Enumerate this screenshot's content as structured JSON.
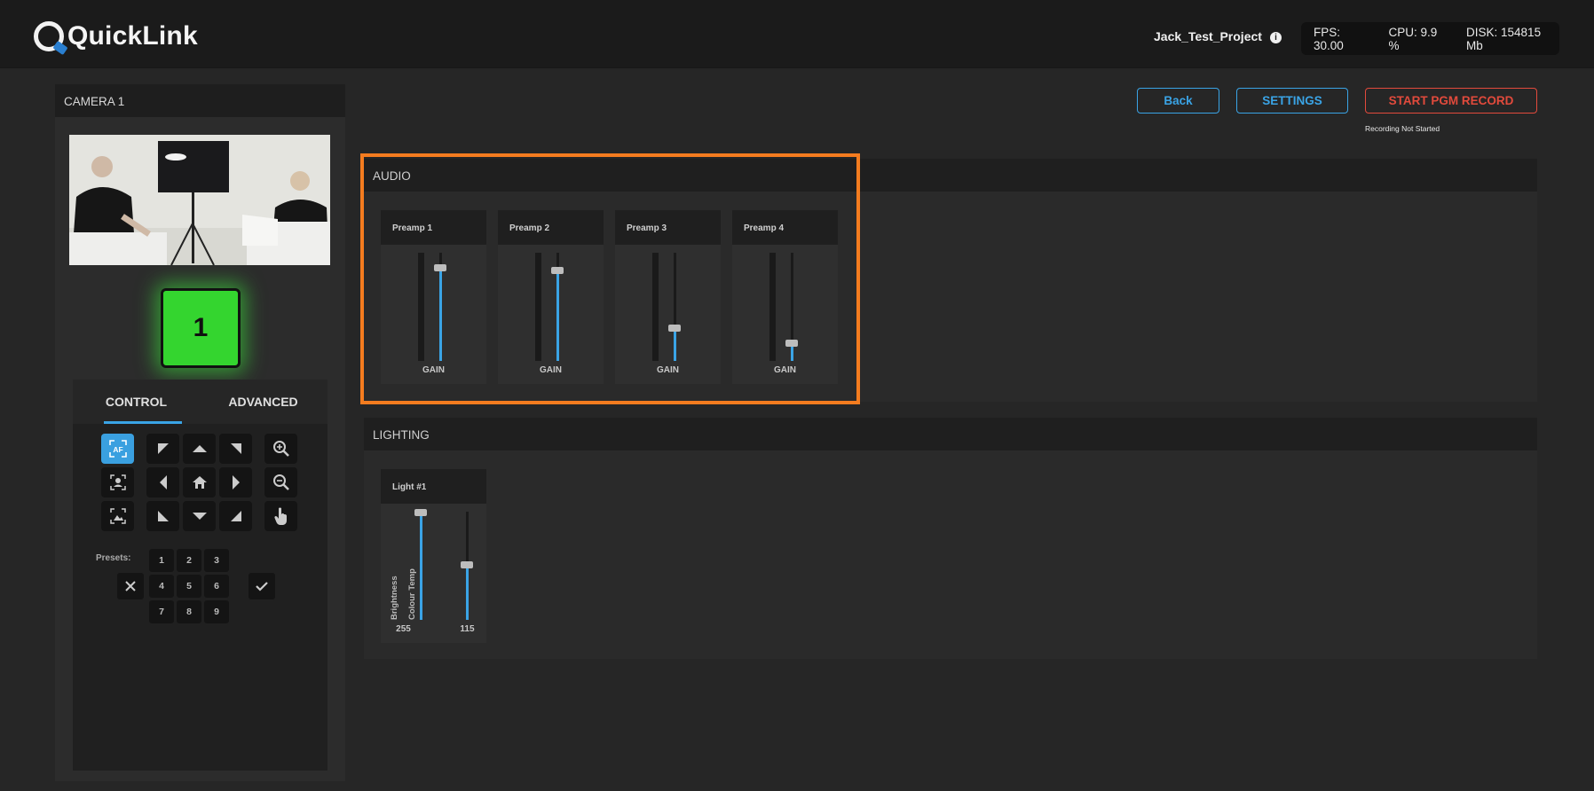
{
  "app": {
    "logo_text": "QuickLink",
    "project": "Jack_Test_Project"
  },
  "stats": {
    "fps": "FPS: 30.00",
    "cpu": "CPU: 9.9 %",
    "disk": "DISK: 154815 Mb"
  },
  "camera": {
    "title": "CAMERA 1",
    "tally_number": "1",
    "tabs": [
      "CONTROL",
      "ADVANCED"
    ],
    "af_label": "AF",
    "presets_label": "Presets:",
    "presets": [
      "1",
      "2",
      "3",
      "4",
      "5",
      "6",
      "7",
      "8",
      "9"
    ]
  },
  "actions": {
    "back": "Back",
    "settings": "SETTINGS",
    "record": "START PGM RECORD",
    "record_status": "Recording Not Started"
  },
  "audio": {
    "title": "AUDIO",
    "channels": [
      {
        "name": "Preamp 1",
        "label": "GAIN",
        "level": 0.86
      },
      {
        "name": "Preamp 2",
        "label": "GAIN",
        "level": 0.84
      },
      {
        "name": "Preamp 3",
        "label": "GAIN",
        "level": 0.3
      },
      {
        "name": "Preamp 4",
        "label": "GAIN",
        "level": 0.16
      }
    ]
  },
  "lighting": {
    "title": "LIGHTING",
    "light_name": "Light #1",
    "brightness_label": "Brightness",
    "brightness_value": "255",
    "temp_label": "Colour Temp",
    "temp_value": "115"
  },
  "colors": {
    "accent": "#3aa4e6",
    "record": "#e24a3c",
    "highlight": "#f47c1f",
    "tally": "#34d52f"
  }
}
